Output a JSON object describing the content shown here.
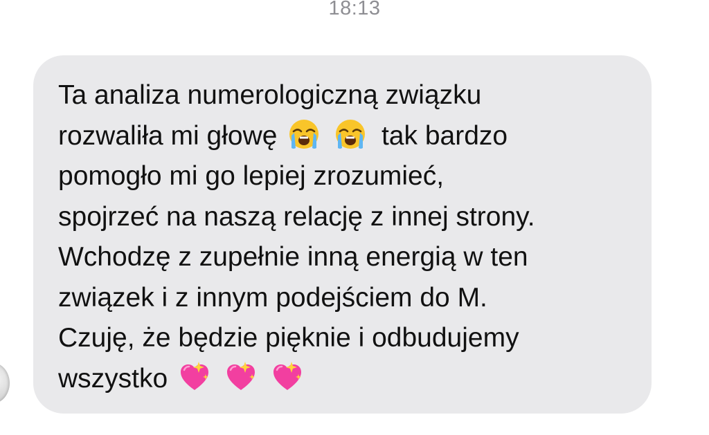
{
  "conversation": {
    "timestamp": "18:13"
  },
  "message": {
    "lines": [
      "Ta analiza numerologiczną związku",
      "rozwaliła mi głowę",
      "tak bardzo",
      "pomogło mi go lepiej zrozumieć,",
      "spojrzeć na naszą relację z innej strony.",
      "Wchodzę z zupełnie inną energią w ten",
      "związek i z innym podejściem do M.",
      "Czuję, że będzie pięknie i odbudujemy",
      "wszystko"
    ],
    "emojis": {
      "crying": "loudly-crying-face-icon",
      "heart": "sparkling-heart-icon"
    }
  },
  "colors": {
    "bubble": "#e9e9eb",
    "text": "#111111",
    "timestamp": "#8e8e93"
  }
}
